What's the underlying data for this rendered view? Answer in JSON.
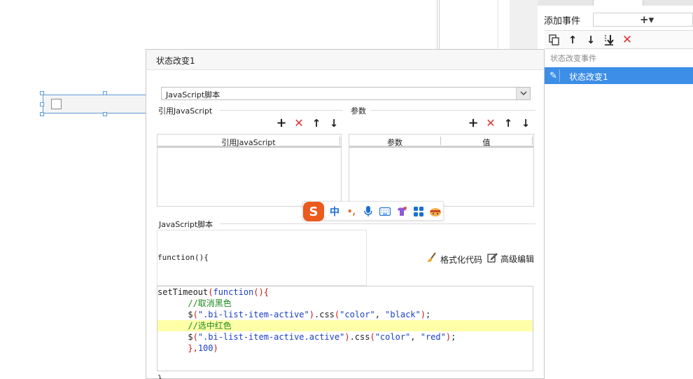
{
  "right_panel": {
    "add_event_label": "添加事件",
    "add_event_button": "+▾",
    "group_label": "状态改变事件",
    "events": [
      {
        "label": "状态改变1",
        "selected": true
      }
    ],
    "toolbar_icons": [
      "copy-icon",
      "arrow-up-icon",
      "arrow-down-icon",
      "move-bottom-icon",
      "delete-icon"
    ]
  },
  "dialog": {
    "title": "状态改变1",
    "script_type": {
      "selected": "JavaScript脚本"
    },
    "referenced_js": {
      "section_label": "引用JavaScript",
      "column": "引用JavaScript"
    },
    "params": {
      "section_label": "参数",
      "columns": [
        "参数",
        "值"
      ]
    },
    "script": {
      "section_label": "JavaScript脚本",
      "function_header": "function(){",
      "format_label": "格式化代码",
      "advanced_label": "高级编辑",
      "closing": "}",
      "code_lines": [
        "setTimeout(function(){",
        "      //取消黑色",
        "      $(\".bi-list-item-active\").css(\"color\", \"black\");",
        "      //选中红色",
        "      $(\".bi-list-item-active.active\").css(\"color\", \"red\");",
        "      },100)"
      ]
    }
  },
  "ime": {
    "logo": "S",
    "items": [
      "中",
      "•,",
      "mic-icon",
      "keyboard-icon",
      "skin-icon",
      "grid-icon",
      "emoji-icon"
    ],
    "mode_label": "中"
  },
  "colors": {
    "accent": "#3d8ee6",
    "delete": "#e03030",
    "highlight_line": "#ffffa8"
  }
}
